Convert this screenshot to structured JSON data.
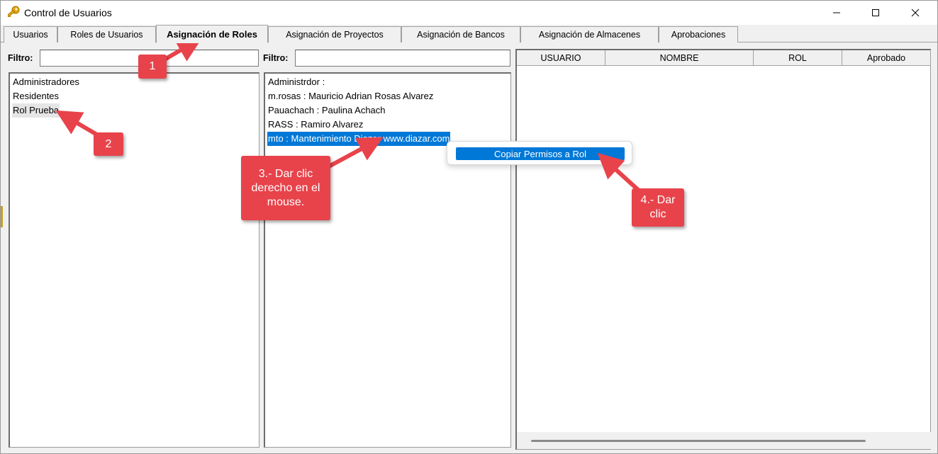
{
  "window": {
    "title": "Control de Usuarios",
    "icon": "key-icon",
    "controls": [
      "minimize-icon",
      "maximize-icon",
      "close-icon"
    ]
  },
  "tabs": [
    {
      "label": "Usuarios",
      "active": false
    },
    {
      "label": "Roles de Usuarios",
      "active": false
    },
    {
      "label": "Asignación de Roles",
      "active": true
    },
    {
      "label": "Asignación de Proyectos",
      "active": false
    },
    {
      "label": "Asignación de Bancos",
      "active": false
    },
    {
      "label": "Asignación de Almacenes",
      "active": false
    },
    {
      "label": "Aprobaciones",
      "active": false
    }
  ],
  "roles_panel": {
    "filter_label": "Filtro:",
    "filter_value": "",
    "items": [
      "Administradores",
      "Residentes",
      "Rol Prueba"
    ],
    "hovered_index": 2
  },
  "users_panel": {
    "filter_label": "Filtro:",
    "filter_value": "",
    "items": [
      "Administrdor :",
      "m.rosas : Mauricio Adrian Rosas Alvarez",
      "Pauachach : Paulina Achach",
      "RASS : Ramiro Alvarez",
      "mto : Mantenimiento Diazar www.diazar.com"
    ],
    "selected_index": 4
  },
  "grid": {
    "columns": [
      "USUARIO",
      "NOMBRE",
      "ROL",
      "Aprobado"
    ],
    "rows": []
  },
  "context_menu": {
    "items": [
      "Copiar Permisos a Rol"
    ]
  },
  "annotations": {
    "callout_1": "1",
    "callout_2": "2",
    "callout_3": "3.- Dar clic derecho en el mouse.",
    "callout_4": "4.- Dar clic",
    "color": "#e8434b"
  },
  "colors": {
    "selection": "#0078d7",
    "window_bg": "#f0f0f0"
  }
}
